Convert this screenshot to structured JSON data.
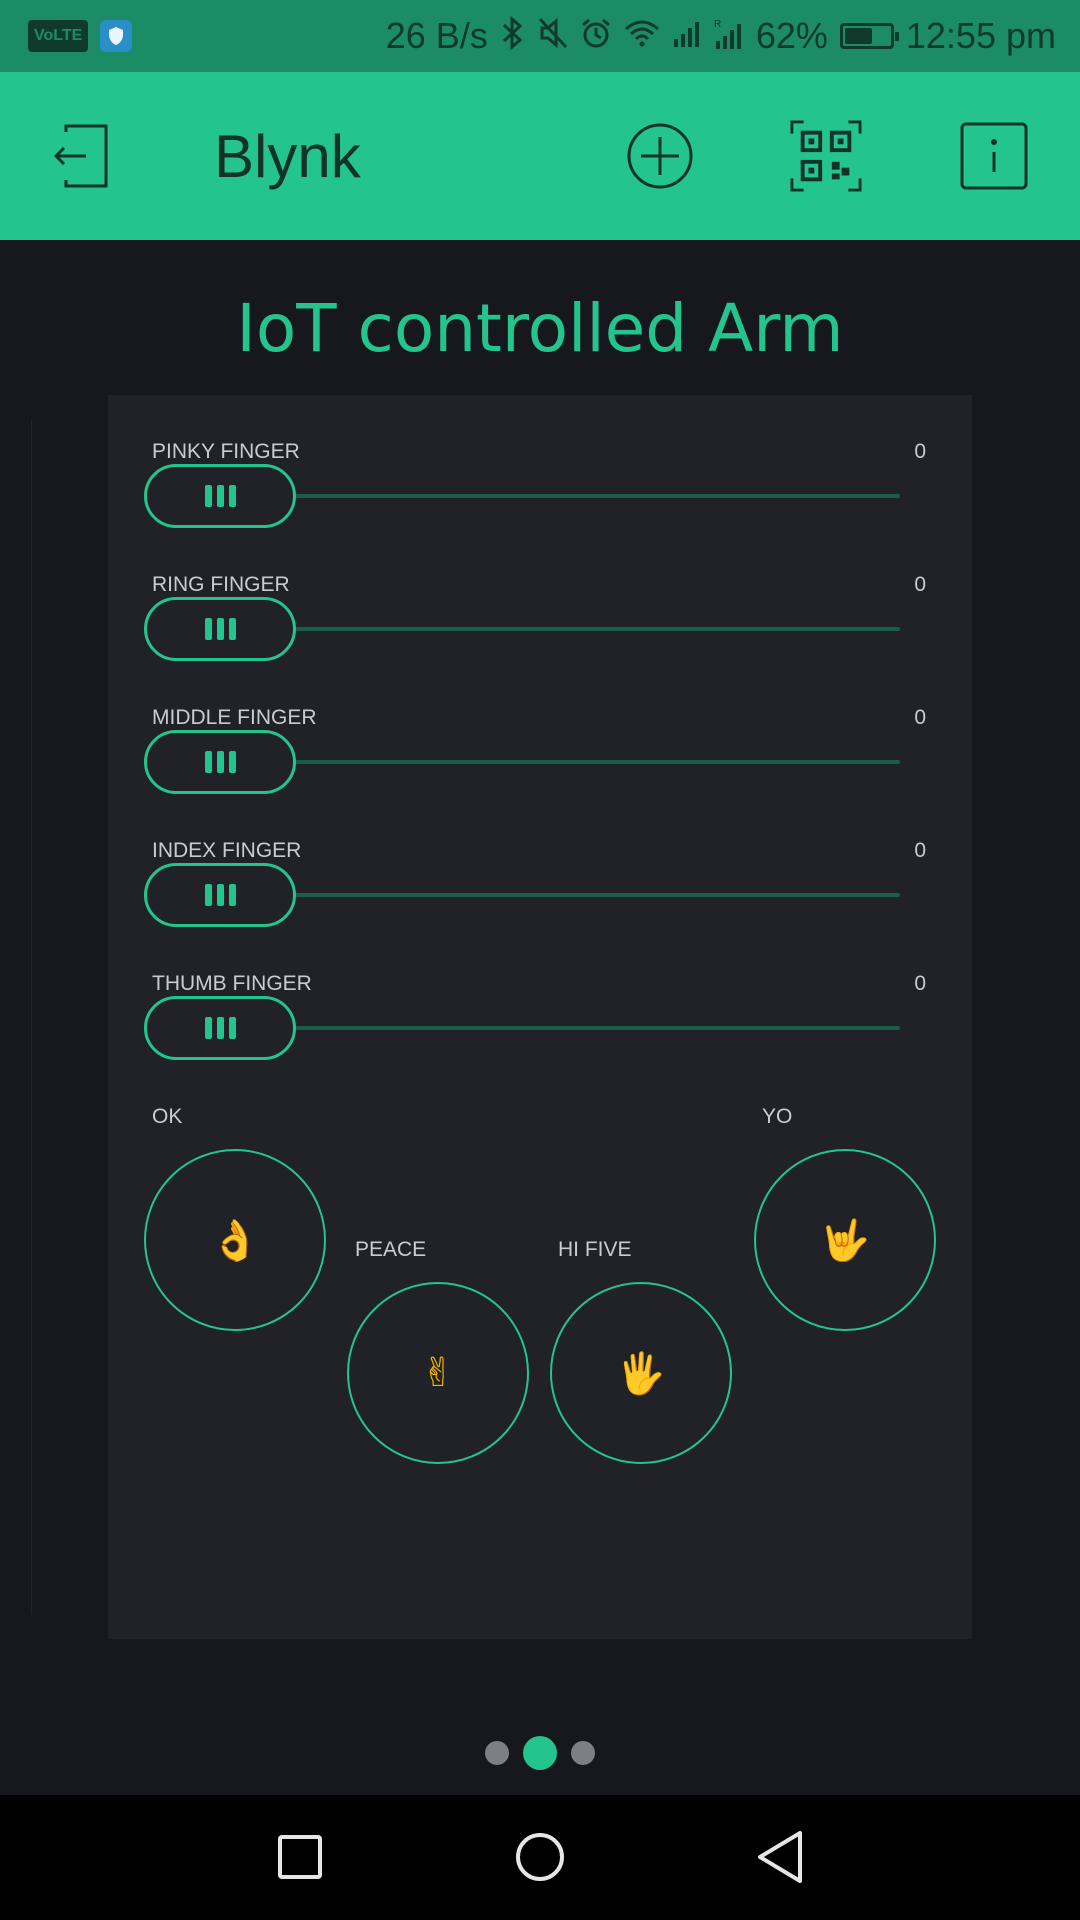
{
  "status_bar": {
    "volte": "VoLTE",
    "net_speed": "26 B/s",
    "battery_pct": "62%",
    "battery_level": 0.62,
    "time": "12:55 pm",
    "icons": [
      "bluetooth-icon",
      "mute-icon",
      "alarm-icon",
      "wifi-icon",
      "signal-icon",
      "signal-roaming-icon",
      "battery-icon"
    ]
  },
  "app_bar": {
    "title": "Blynk",
    "icons": [
      "logout-icon",
      "add-icon",
      "qr-code-icon",
      "info-icon"
    ]
  },
  "dashboard": {
    "title": "IoT controlled Arm"
  },
  "sliders": [
    {
      "label": "PINKY FINGER",
      "value": "0"
    },
    {
      "label": "RING FINGER",
      "value": "0"
    },
    {
      "label": "MIDDLE FINGER",
      "value": "0"
    },
    {
      "label": "INDEX FINGER",
      "value": "0"
    },
    {
      "label": "THUMB FINGER",
      "value": "0"
    }
  ],
  "buttons": [
    {
      "label": "OK",
      "emoji": "👌"
    },
    {
      "label": "PEACE",
      "emoji": "✌"
    },
    {
      "label": "HI FIVE",
      "emoji": "🖐"
    },
    {
      "label": "YO",
      "emoji": "🤟"
    }
  ],
  "pagination": {
    "total": 3,
    "active": 2
  },
  "colors": {
    "accent": "#23c48e",
    "status_bar": "#1c8c67",
    "background": "#17181d",
    "panel": "#212227"
  }
}
